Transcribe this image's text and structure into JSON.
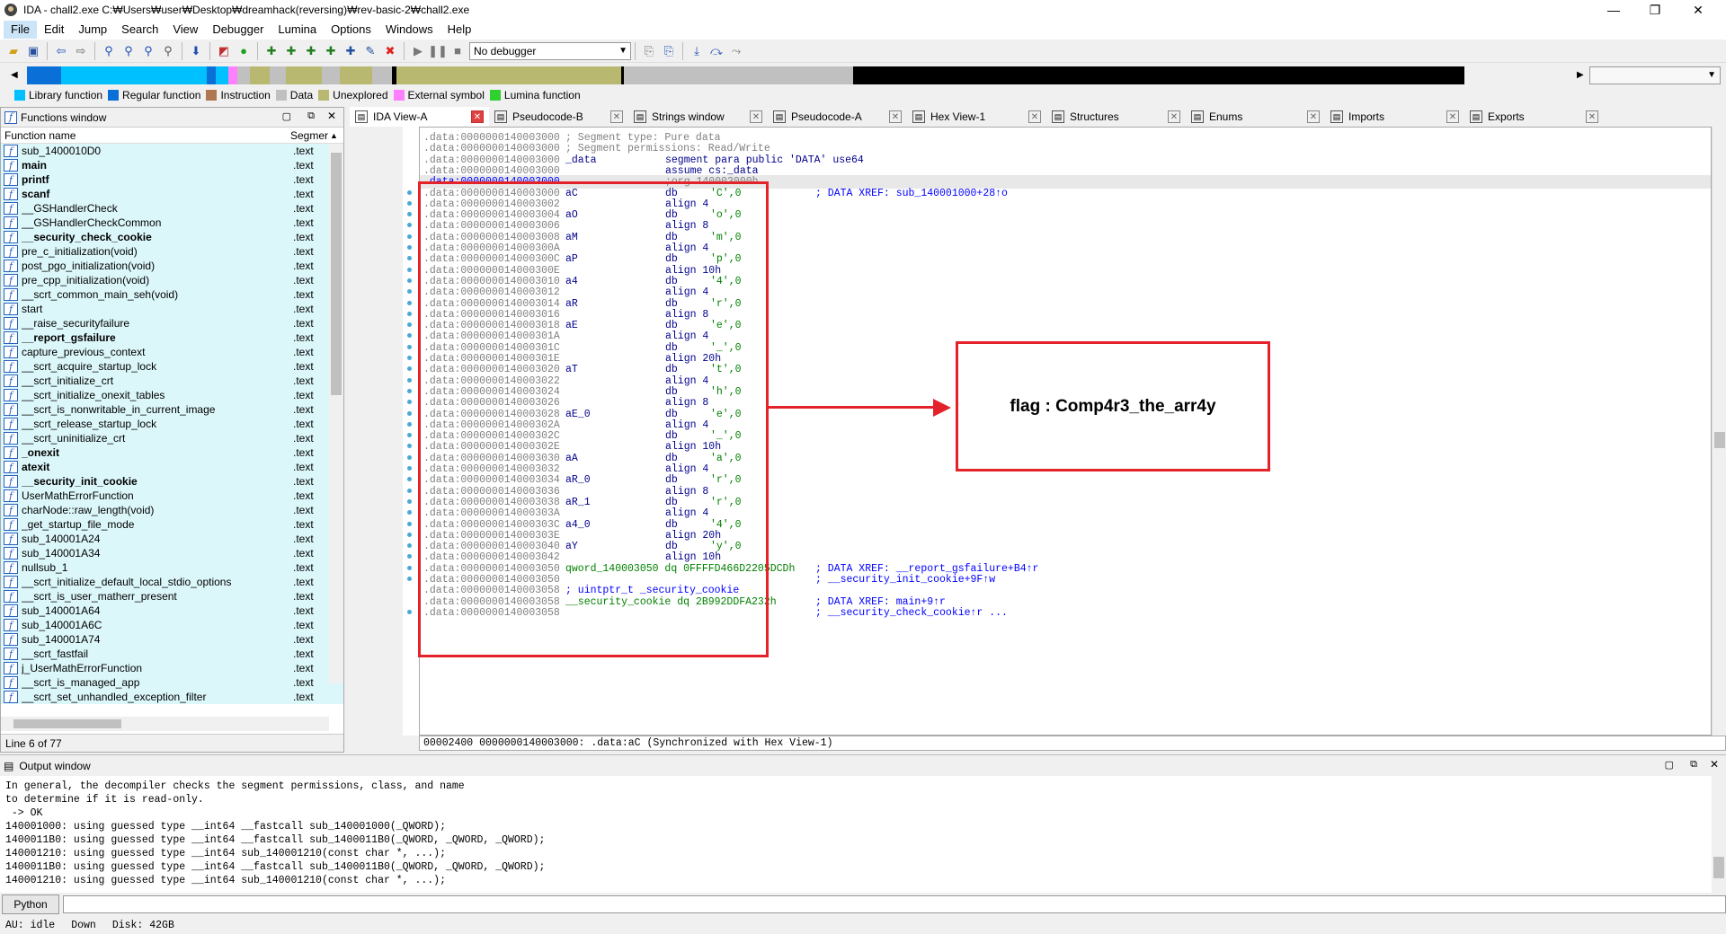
{
  "window": {
    "title": "IDA - chall2.exe C:₩Users₩user₩Desktop₩dreamhack(reversing)₩rev-basic-2₩chall2.exe",
    "minimize": "—",
    "maximize": "❐",
    "close": "✕"
  },
  "menu": [
    "File",
    "Edit",
    "Jump",
    "Search",
    "View",
    "Debugger",
    "Lumina",
    "Options",
    "Windows",
    "Help"
  ],
  "toolbar": {
    "debugger_select": "No debugger"
  },
  "legend": [
    {
      "label": "Library function",
      "color": "#00c0ff"
    },
    {
      "label": "Regular function",
      "color": "#0a6fd6"
    },
    {
      "label": "Instruction",
      "color": "#b07850"
    },
    {
      "label": "Data",
      "color": "#c0c0c0"
    },
    {
      "label": "Unexplored",
      "color": "#b8b870"
    },
    {
      "label": "External symbol",
      "color": "#ff80ff"
    },
    {
      "label": "Lumina function",
      "color": "#30d030"
    }
  ],
  "functions_window": {
    "title": "Functions window",
    "col_name": "Function name",
    "col_segment": "Segmer",
    "status": "Line 6 of 77",
    "rows": [
      {
        "name": "sub_1400010D0",
        "seg": ".text",
        "bold": false
      },
      {
        "name": "main",
        "seg": ".text",
        "bold": true
      },
      {
        "name": "printf",
        "seg": ".text",
        "bold": true
      },
      {
        "name": "scanf",
        "seg": ".text",
        "bold": true
      },
      {
        "name": "__GSHandlerCheck",
        "seg": ".text",
        "bold": false
      },
      {
        "name": "__GSHandlerCheckCommon",
        "seg": ".text",
        "bold": false
      },
      {
        "name": "__security_check_cookie",
        "seg": ".text",
        "bold": true
      },
      {
        "name": "pre_c_initialization(void)",
        "seg": ".text",
        "bold": false
      },
      {
        "name": "post_pgo_initialization(void)",
        "seg": ".text",
        "bold": false
      },
      {
        "name": "pre_cpp_initialization(void)",
        "seg": ".text",
        "bold": false
      },
      {
        "name": "__scrt_common_main_seh(void)",
        "seg": ".text",
        "bold": false
      },
      {
        "name": "start",
        "seg": ".text",
        "bold": false
      },
      {
        "name": "__raise_securityfailure",
        "seg": ".text",
        "bold": false
      },
      {
        "name": "__report_gsfailure",
        "seg": ".text",
        "bold": true
      },
      {
        "name": "capture_previous_context",
        "seg": ".text",
        "bold": false
      },
      {
        "name": "__scrt_acquire_startup_lock",
        "seg": ".text",
        "bold": false
      },
      {
        "name": "__scrt_initialize_crt",
        "seg": ".text",
        "bold": false
      },
      {
        "name": "__scrt_initialize_onexit_tables",
        "seg": ".text",
        "bold": false
      },
      {
        "name": "__scrt_is_nonwritable_in_current_image",
        "seg": ".text",
        "bold": false
      },
      {
        "name": "__scrt_release_startup_lock",
        "seg": ".text",
        "bold": false
      },
      {
        "name": "__scrt_uninitialize_crt",
        "seg": ".text",
        "bold": false
      },
      {
        "name": "_onexit",
        "seg": ".text",
        "bold": true
      },
      {
        "name": "atexit",
        "seg": ".text",
        "bold": true
      },
      {
        "name": "__security_init_cookie",
        "seg": ".text",
        "bold": true
      },
      {
        "name": "UserMathErrorFunction",
        "seg": ".text",
        "bold": false
      },
      {
        "name": "charNode::raw_length(void)",
        "seg": ".text",
        "bold": false
      },
      {
        "name": "_get_startup_file_mode",
        "seg": ".text",
        "bold": false
      },
      {
        "name": "sub_140001A24",
        "seg": ".text",
        "bold": false
      },
      {
        "name": "sub_140001A34",
        "seg": ".text",
        "bold": false
      },
      {
        "name": "nullsub_1",
        "seg": ".text",
        "bold": false
      },
      {
        "name": "__scrt_initialize_default_local_stdio_options",
        "seg": ".text",
        "bold": false
      },
      {
        "name": "__scrt_is_user_matherr_present",
        "seg": ".text",
        "bold": false
      },
      {
        "name": "sub_140001A64",
        "seg": ".text",
        "bold": false
      },
      {
        "name": "sub_140001A6C",
        "seg": ".text",
        "bold": false
      },
      {
        "name": "sub_140001A74",
        "seg": ".text",
        "bold": false
      },
      {
        "name": "__scrt_fastfail",
        "seg": ".text",
        "bold": false
      },
      {
        "name": "j_UserMathErrorFunction",
        "seg": ".text",
        "bold": false
      },
      {
        "name": "__scrt_is_managed_app",
        "seg": ".text",
        "bold": false
      },
      {
        "name": "__scrt_set_unhandled_exception_filter",
        "seg": ".text",
        "bold": false
      }
    ]
  },
  "tabs": [
    {
      "label": "IDA View-A",
      "icon": "ida-view-icon",
      "active": true
    },
    {
      "label": "Pseudocode-B",
      "icon": "pseudocode-icon",
      "active": false
    },
    {
      "label": "Strings window",
      "icon": "strings-icon",
      "active": false
    },
    {
      "label": "Pseudocode-A",
      "icon": "pseudocode-icon",
      "active": false
    },
    {
      "label": "Hex View-1",
      "icon": "hex-icon",
      "active": false
    },
    {
      "label": "Structures",
      "icon": "structures-icon",
      "active": false
    },
    {
      "label": "Enums",
      "icon": "enums-icon",
      "active": false
    },
    {
      "label": "Imports",
      "icon": "imports-icon",
      "active": false
    },
    {
      "label": "Exports",
      "icon": "exports-icon",
      "active": false
    }
  ],
  "disasm": [
    {
      "addr": ".data:0000000140003000",
      "label": "; Segment type: Pure data",
      "mn": "",
      "op": "",
      "cm": "",
      "gray": true
    },
    {
      "addr": ".data:0000000140003000",
      "label": "; Segment permissions: Read/Write",
      "mn": "",
      "op": "",
      "cm": "",
      "gray": true
    },
    {
      "addr": ".data:0000000140003000",
      "label": "_data",
      "mn": "segment para public 'DATA' use64",
      "op": "",
      "cm": ""
    },
    {
      "addr": ".data:0000000140003000",
      "label": "",
      "mn": "assume cs:_data",
      "op": "",
      "cm": ""
    },
    {
      "addr": ".data:0000000140003000",
      "label": "",
      "mn": ";org 140003000h",
      "op": "",
      "cm": "",
      "hl": true,
      "gray": true
    },
    {
      "addr": ".data:0000000140003000",
      "label": "aC",
      "mn": "db",
      "op": "'C',0",
      "cm": "; DATA XREF: sub_140001000+28↑o"
    },
    {
      "addr": ".data:0000000140003002",
      "label": "",
      "mn": "align 4",
      "op": "",
      "cm": ""
    },
    {
      "addr": ".data:0000000140003004",
      "label": "aO",
      "mn": "db",
      "op": "'o',0",
      "cm": ""
    },
    {
      "addr": ".data:0000000140003006",
      "label": "",
      "mn": "align 8",
      "op": "",
      "cm": ""
    },
    {
      "addr": ".data:0000000140003008",
      "label": "aM",
      "mn": "db",
      "op": "'m',0",
      "cm": ""
    },
    {
      "addr": ".data:000000014000300A",
      "label": "",
      "mn": "align 4",
      "op": "",
      "cm": ""
    },
    {
      "addr": ".data:000000014000300C",
      "label": "aP",
      "mn": "db",
      "op": "'p',0",
      "cm": ""
    },
    {
      "addr": ".data:000000014000300E",
      "label": "",
      "mn": "align 10h",
      "op": "",
      "cm": ""
    },
    {
      "addr": ".data:0000000140003010",
      "label": "a4",
      "mn": "db",
      "op": "'4',0",
      "cm": ""
    },
    {
      "addr": ".data:0000000140003012",
      "label": "",
      "mn": "align 4",
      "op": "",
      "cm": ""
    },
    {
      "addr": ".data:0000000140003014",
      "label": "aR",
      "mn": "db",
      "op": "'r',0",
      "cm": ""
    },
    {
      "addr": ".data:0000000140003016",
      "label": "",
      "mn": "align 8",
      "op": "",
      "cm": ""
    },
    {
      "addr": ".data:0000000140003018",
      "label": "aE",
      "mn": "db",
      "op": "'e',0",
      "cm": ""
    },
    {
      "addr": ".data:000000014000301A",
      "label": "",
      "mn": "align 4",
      "op": "",
      "cm": ""
    },
    {
      "addr": ".data:000000014000301C",
      "label": "",
      "mn": "db",
      "op": "'_',0",
      "cm": ""
    },
    {
      "addr": ".data:000000014000301E",
      "label": "",
      "mn": "align 20h",
      "op": "",
      "cm": ""
    },
    {
      "addr": ".data:0000000140003020",
      "label": "aT",
      "mn": "db",
      "op": "'t',0",
      "cm": ""
    },
    {
      "addr": ".data:0000000140003022",
      "label": "",
      "mn": "align 4",
      "op": "",
      "cm": ""
    },
    {
      "addr": ".data:0000000140003024",
      "label": "",
      "mn": "db",
      "op": "'h',0",
      "cm": ""
    },
    {
      "addr": ".data:0000000140003026",
      "label": "",
      "mn": "align 8",
      "op": "",
      "cm": ""
    },
    {
      "addr": ".data:0000000140003028",
      "label": "aE_0",
      "mn": "db",
      "op": "'e',0",
      "cm": ""
    },
    {
      "addr": ".data:000000014000302A",
      "label": "",
      "mn": "align 4",
      "op": "",
      "cm": ""
    },
    {
      "addr": ".data:000000014000302C",
      "label": "",
      "mn": "db",
      "op": "'_',0",
      "cm": ""
    },
    {
      "addr": ".data:000000014000302E",
      "label": "",
      "mn": "align 10h",
      "op": "",
      "cm": ""
    },
    {
      "addr": ".data:0000000140003030",
      "label": "aA",
      "mn": "db",
      "op": "'a',0",
      "cm": ""
    },
    {
      "addr": ".data:0000000140003032",
      "label": "",
      "mn": "align 4",
      "op": "",
      "cm": ""
    },
    {
      "addr": ".data:0000000140003034",
      "label": "aR_0",
      "mn": "db",
      "op": "'r',0",
      "cm": ""
    },
    {
      "addr": ".data:0000000140003036",
      "label": "",
      "mn": "align 8",
      "op": "",
      "cm": ""
    },
    {
      "addr": ".data:0000000140003038",
      "label": "aR_1",
      "mn": "db",
      "op": "'r',0",
      "cm": ""
    },
    {
      "addr": ".data:000000014000303A",
      "label": "",
      "mn": "align 4",
      "op": "",
      "cm": ""
    },
    {
      "addr": ".data:000000014000303C",
      "label": "a4_0",
      "mn": "db",
      "op": "'4',0",
      "cm": ""
    },
    {
      "addr": ".data:000000014000303E",
      "label": "",
      "mn": "align 20h",
      "op": "",
      "cm": ""
    },
    {
      "addr": ".data:0000000140003040",
      "label": "aY",
      "mn": "db",
      "op": "'y',0",
      "cm": ""
    },
    {
      "addr": ".data:0000000140003042",
      "label": "",
      "mn": "align 10h",
      "op": "",
      "cm": ""
    },
    {
      "addr": ".data:0000000140003050",
      "label": "qword_140003050 dq 0FFFFD466D2205DCDh",
      "mn": "",
      "op": "",
      "cm": "; DATA XREF: __report_gsfailure+B4↑r"
    },
    {
      "addr": ".data:0000000140003050",
      "label": "",
      "mn": "",
      "op": "",
      "cm": "; __security_init_cookie+9F↑w"
    },
    {
      "addr": ".data:0000000140003058",
      "label": "; uintptr_t _security_cookie",
      "mn": "",
      "op": "",
      "cm": ""
    },
    {
      "addr": ".data:0000000140003058",
      "label": "__security_cookie dq 2B992DDFA232h",
      "mn": "",
      "op": "",
      "cm": "; DATA XREF: main+9↑r"
    },
    {
      "addr": ".data:0000000140003058",
      "label": "",
      "mn": "",
      "op": "",
      "cm": "; __security_check_cookie↑r ..."
    }
  ],
  "disasm_status": "00002400 0000000140003000: .data:aC (Synchronized with Hex View-1)",
  "annotation": {
    "flag_text": "flag : Comp4r3_the_arr4y"
  },
  "output_window": {
    "title": "Output window",
    "lines": [
      "In general, the decompiler checks the segment permissions, class, and name",
      "to determine if it is read-only.",
      " -> OK",
      "140001000: using guessed type __int64 __fastcall sub_140001000(_QWORD);",
      "1400011B0: using guessed type __int64 __fastcall sub_1400011B0(_QWORD, _QWORD, _QWORD);",
      "140001210: using guessed type __int64 sub_140001210(const char *, ...);",
      "1400011B0: using guessed type __int64 __fastcall sub_1400011B0(_QWORD, _QWORD, _QWORD);",
      "140001210: using guessed type __int64 sub_140001210(const char *, ...);"
    ]
  },
  "python_button": "Python",
  "statusbar": {
    "au": "AU:  idle",
    "dir": "Down",
    "disk": "Disk: 42GB"
  }
}
